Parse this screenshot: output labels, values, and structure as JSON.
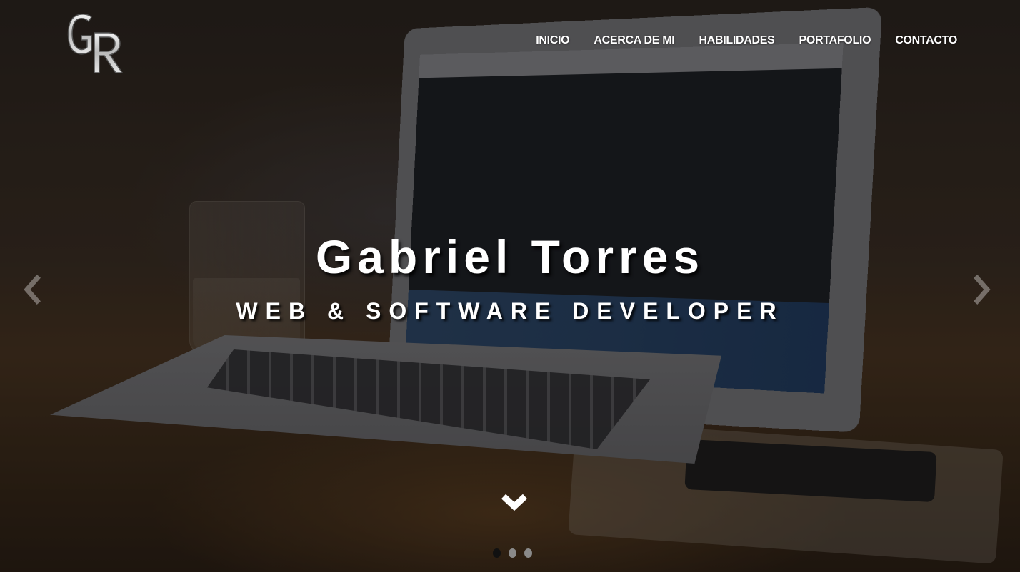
{
  "logo": {
    "text": "GR",
    "icon": "gr-monogram-logo"
  },
  "nav": {
    "items": [
      {
        "label": "INICIO"
      },
      {
        "label": "ACERCA DE MI"
      },
      {
        "label": "HABILIDADES"
      },
      {
        "label": "PORTAFOLIO"
      },
      {
        "label": "CONTACTO"
      }
    ]
  },
  "hero": {
    "title": "Gabriel Torres",
    "subtitle": "WEB & SOFTWARE DEVELOPER"
  },
  "carousel": {
    "prev_icon": "chevron-left-icon",
    "next_icon": "chevron-right-icon",
    "scroll_icon": "chevron-down-icon",
    "slide_count": 3,
    "active_slide": 1
  },
  "colors": {
    "text": "#ffffff",
    "indicator_active": "#111111",
    "indicator_inactive": "#8a8a8a"
  }
}
